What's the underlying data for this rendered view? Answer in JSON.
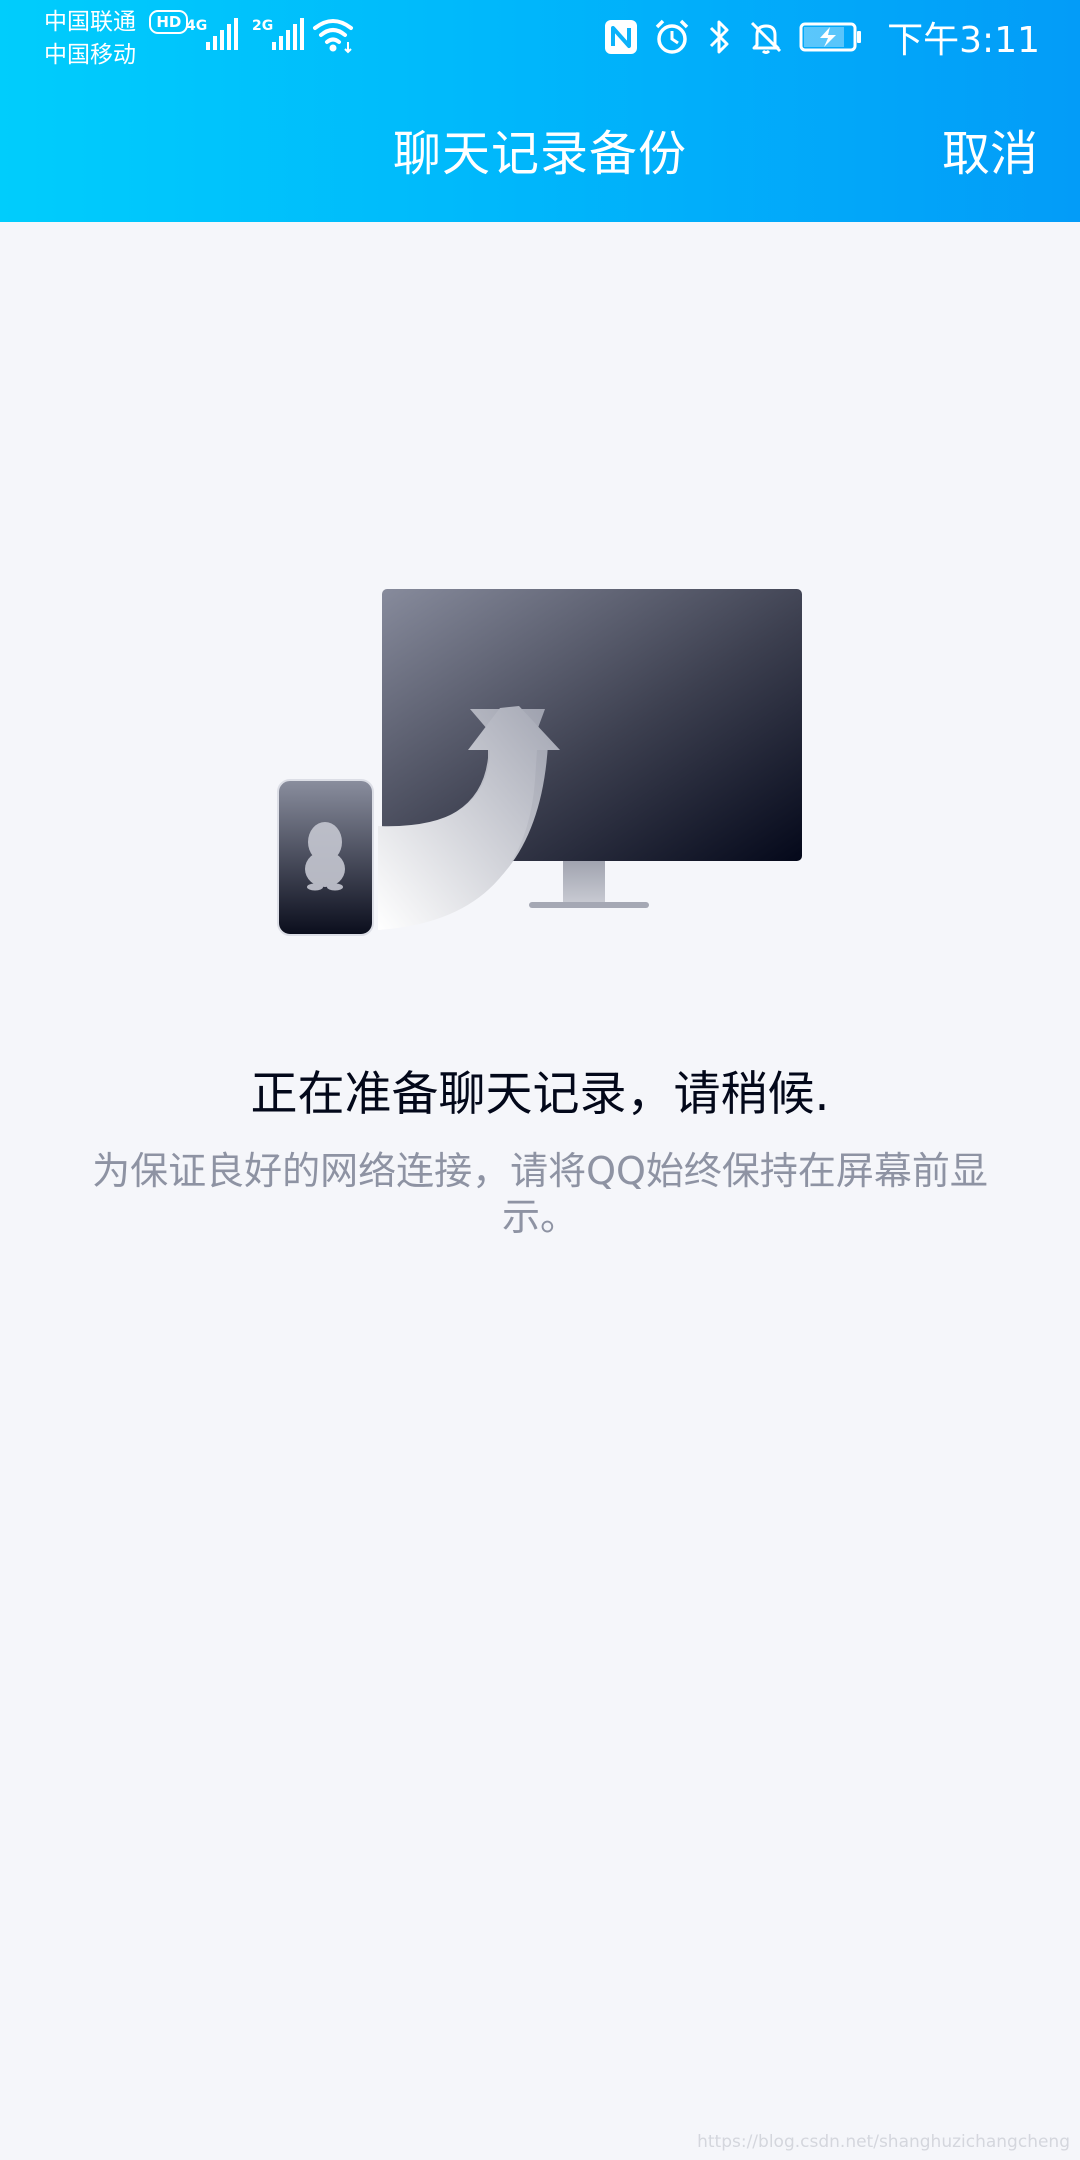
{
  "status_bar": {
    "carrier_1": "中国联通",
    "carrier_1_badge": "HD",
    "carrier_2": "中国移动",
    "network_1": "4G",
    "network_2": "2G",
    "icons": [
      "signal-icon",
      "wifi-icon",
      "nfc-icon",
      "alarm-icon",
      "bluetooth-icon",
      "mute-icon",
      "battery-charging-icon"
    ],
    "time": "下午3:11"
  },
  "navbar": {
    "title": "聊天记录备份",
    "cancel_label": "取消"
  },
  "main": {
    "illustration": "phone-to-computer-backup-icon",
    "status_message": "正在准备聊天记录，请稍候.",
    "hint_message": "为保证良好的网络连接，请将QQ始终保持在屏幕前显示。"
  },
  "watermark": "https://blog.csdn.net/shanghuzichangcheng",
  "colors": {
    "header_gradient_start": "#00cdfc",
    "header_gradient_end": "#039cf8",
    "background": "#f5f6fa",
    "primary_text": "#03081a",
    "secondary_text": "#8e93a3"
  }
}
